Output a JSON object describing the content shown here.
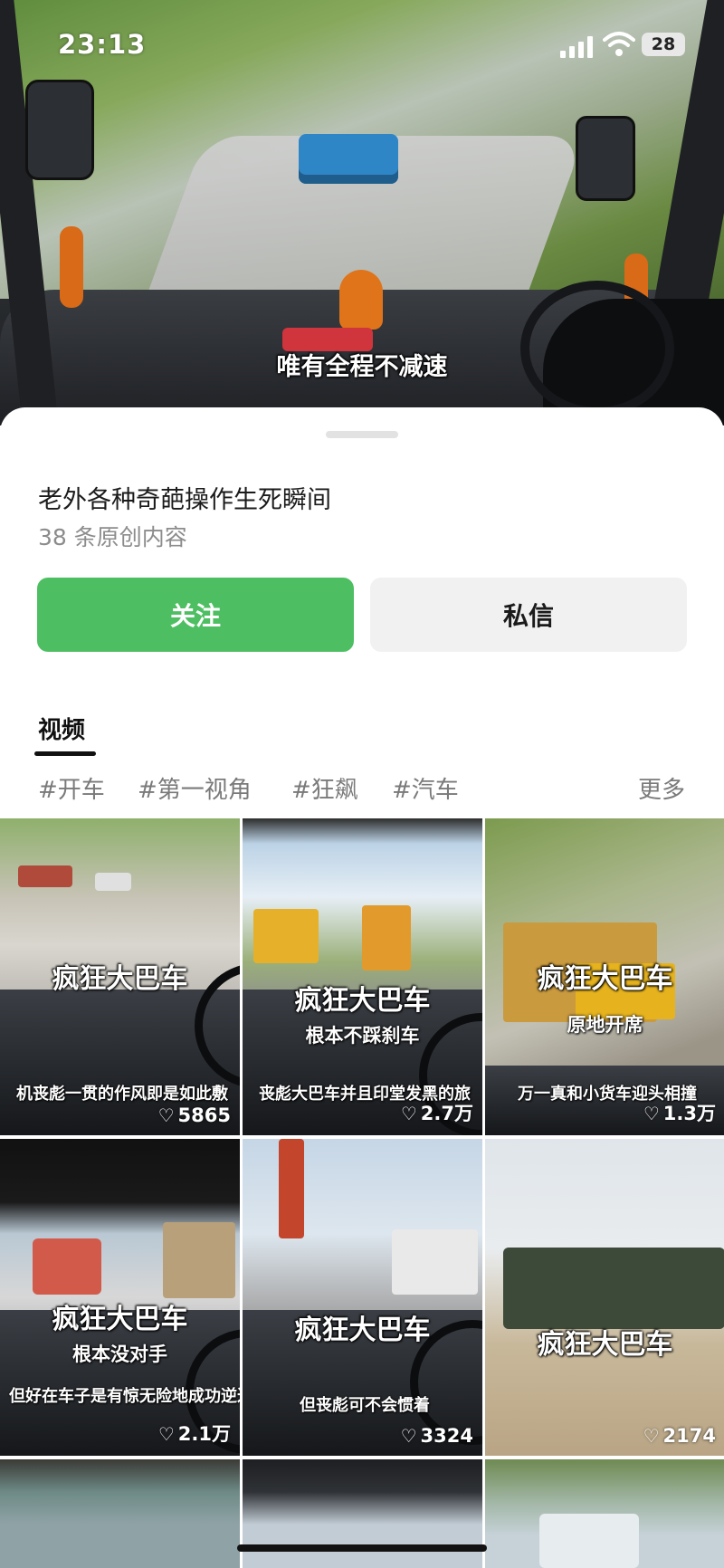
{
  "status_bar": {
    "time": "23:13",
    "battery": "28"
  },
  "hero": {
    "caption": "唯有全程不减速"
  },
  "profile": {
    "title": "老外各种奇葩操作生死瞬间",
    "subtitle": "38 条原创内容"
  },
  "actions": {
    "follow_label": "关注",
    "message_label": "私信"
  },
  "tabs": {
    "videos_label": "视频"
  },
  "tags": [
    "#开车",
    "#第一视角",
    "#狂飙",
    "#汽车"
  ],
  "tags_more": "更多",
  "videos": [
    {
      "title": "疯狂大巴车",
      "subtitle": "",
      "caption": "机丧彪一贯的作风即是如此敷",
      "likes": "5865"
    },
    {
      "title": "疯狂大巴车",
      "subtitle": "根本不踩刹车",
      "caption": "丧彪大巴车并且印堂发黑的旅",
      "likes": "2.7万"
    },
    {
      "title": "疯狂大巴车",
      "subtitle": "原地开席",
      "caption": "万一真和小货车迎头相撞",
      "likes": "1.3万"
    },
    {
      "title": "疯狂大巴车",
      "subtitle": "根本没对手",
      "caption": "但好在车子是有惊无险地成功逆过",
      "likes": "2.1万"
    },
    {
      "title": "疯狂大巴车",
      "subtitle": "",
      "caption": "但丧彪可不会惯着",
      "likes": "3324"
    },
    {
      "title": "疯狂大巴车",
      "subtitle": "",
      "caption": "",
      "likes": "2174"
    }
  ],
  "colors": {
    "follow_green": "#4dbf62",
    "secondary_button": "#f1f1f1",
    "muted_text": "#8c8c8c"
  },
  "icons": {
    "like": "heart-outline-icon",
    "signal": "cellular-signal-icon",
    "wifi": "wifi-icon",
    "battery": "battery-icon"
  }
}
